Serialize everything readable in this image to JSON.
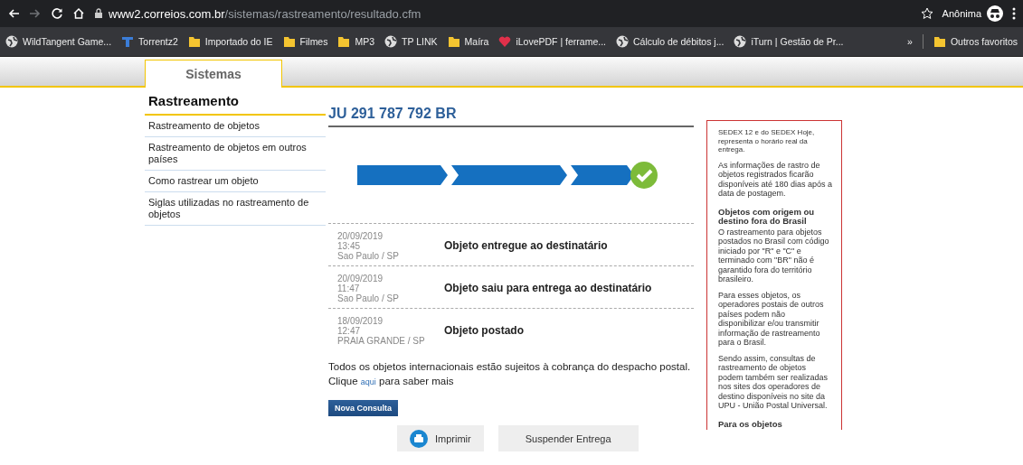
{
  "browser": {
    "url_host": "www2.correios.com.br",
    "url_path": "/sistemas/rastreamento/resultado.cfm",
    "forward_disabled": true,
    "profile": "Anônima",
    "bookmarks": [
      {
        "label": "WildTangent Game...",
        "kind": "globe"
      },
      {
        "label": "Torrentz2",
        "kind": "torrent"
      },
      {
        "label": "Importado do IE",
        "kind": "folder"
      },
      {
        "label": "Filmes",
        "kind": "folder"
      },
      {
        "label": "MP3",
        "kind": "folder"
      },
      {
        "label": "TP LINK",
        "kind": "globe"
      },
      {
        "label": "Maíra",
        "kind": "folder"
      },
      {
        "label": "iLovePDF | ferrame...",
        "kind": "heart"
      },
      {
        "label": "Cálculo de débitos j...",
        "kind": "globe"
      },
      {
        "label": "iTurn | Gestão de Pr...",
        "kind": "globe"
      }
    ],
    "overflow": "»",
    "other_bookmarks": "Outros favoritos"
  },
  "site_tabs": [
    {
      "label": "Sistemas",
      "selected": true
    }
  ],
  "sidebar": {
    "title": "Rastreamento",
    "items": [
      "Rastreamento de objetos",
      "Rastreamento de objetos em outros países",
      "Como rastrear um objeto",
      "Siglas utilizadas no rastreamento de objetos"
    ]
  },
  "tracking": {
    "code": "JU 291 787 792 BR",
    "steps": [
      {
        "done": true
      },
      {
        "done": true
      },
      {
        "done": true
      }
    ],
    "delivered": true,
    "events": [
      {
        "date": "20/09/2019",
        "time": "13:45",
        "place": "Sao Paulo / SP",
        "status": "Objeto entregue ao destinatário"
      },
      {
        "date": "20/09/2019",
        "time": "11:47",
        "place": "Sao Paulo / SP",
        "status": "Objeto saiu para entrega ao destinatário"
      },
      {
        "date": "18/09/2019",
        "time": "12:47",
        "place": "PRAIA GRANDE / SP",
        "status": "Objeto postado"
      }
    ],
    "notice": "Todos os objetos internacionais estão sujeitos à cobrança do despacho postal.",
    "notice_prefix": "Clique",
    "notice_link": "aqui",
    "notice_suffix": "para saber mais",
    "new_query": "Nova Consulta",
    "print": "Imprimir",
    "suspend": "Suspender Entrega"
  },
  "info_box": [
    {
      "kind": "small",
      "text": "SEDEX 12 e do SEDEX Hoje, representa o horário real da entrega."
    },
    {
      "kind": "text",
      "text": "As informações de rastro de objetos registrados ficarão disponíveis até 180 dias após a data de postagem."
    },
    {
      "kind": "heading",
      "text": "Objetos com origem ou destino fora do Brasil"
    },
    {
      "kind": "text",
      "text": "O rastreamento para objetos postados no Brasil com código iniciado por \"R\" e \"C\" e terminado com \"BR\" não é garantido fora do território brasileiro."
    },
    {
      "kind": "text",
      "text": "Para esses objetos, os operadores postais de outros países podem não disponibilizar e/ou transmitir informação de rastreamento para o Brasil."
    },
    {
      "kind": "text",
      "text": "Sendo assim, consultas de rastreamento de objetos podem também ser realizadas nos sites dos operadores de destino disponíveis no site da UPU - União Postal Universal."
    },
    {
      "kind": "heading",
      "text": "Para os objetos"
    }
  ]
}
